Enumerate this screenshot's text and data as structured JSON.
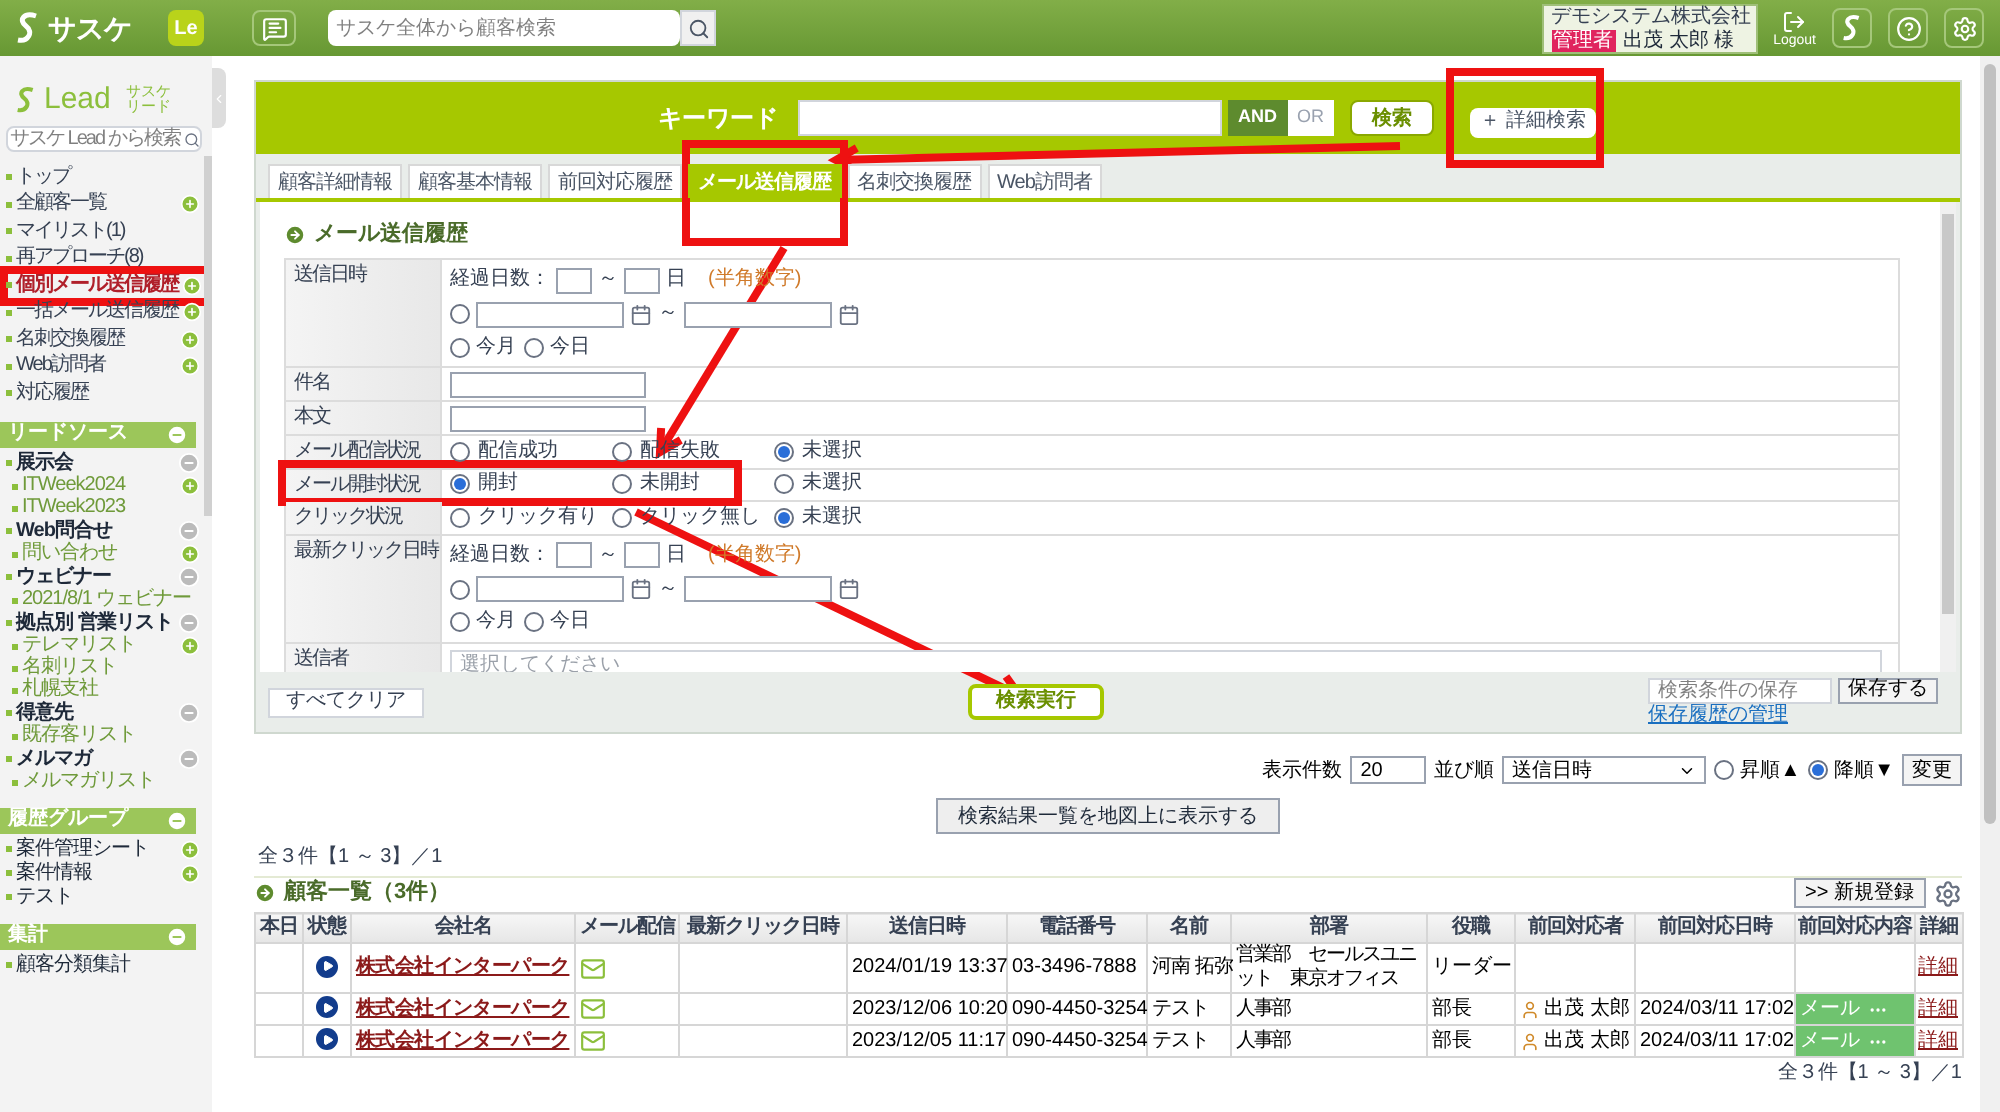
{
  "header": {
    "logo": "サスケ",
    "app_badge": "Le",
    "search_placeholder": "サスケ全体から顧客検索",
    "company": "デモシステム株式会社",
    "role": "管理者",
    "user": "出茂 太郎 様",
    "logout": "Logout"
  },
  "sidebar": {
    "logo": "Lead",
    "logo_sub": "サスケリード",
    "search_placeholder": "サスケ Lead から検索",
    "nav": [
      {
        "label": "トップ",
        "add": false,
        "selected": false
      },
      {
        "label": "全顧客一覧",
        "add": true,
        "selected": false
      },
      {
        "label": "マイリスト(1)",
        "add": false,
        "selected": false
      },
      {
        "label": "再アプローチ(8)",
        "add": false,
        "selected": false
      },
      {
        "label": "個別メール送信履歴",
        "add": true,
        "selected": true
      },
      {
        "label": "一括メール送信履歴",
        "add": true,
        "selected": false
      },
      {
        "label": "名刺交換履歴",
        "add": true,
        "selected": false
      },
      {
        "label": "Web訪問者",
        "add": true,
        "selected": false
      },
      {
        "label": "対応履歴",
        "add": false,
        "selected": false
      }
    ],
    "sections": [
      {
        "title": "リードソース",
        "items": [
          {
            "label": "展示会",
            "add": false,
            "children": [
              {
                "label": "ITWeek2024",
                "add": true
              },
              {
                "label": "ITWeek2023",
                "add": false
              }
            ]
          },
          {
            "label": "Web問合せ",
            "add": false,
            "children": [
              {
                "label": "問い合わせ",
                "add": true
              }
            ]
          },
          {
            "label": "ウェビナー",
            "add": false,
            "children": [
              {
                "label": "2021/8/1 ウェビナー",
                "add": false
              }
            ]
          },
          {
            "label": "拠点別 営業リスト",
            "add": false,
            "children": [
              {
                "label": "テレマリスト",
                "add": true
              },
              {
                "label": "名刺リスト",
                "add": false
              },
              {
                "label": "札幌支社",
                "add": false
              }
            ]
          },
          {
            "label": "得意先",
            "add": false,
            "children": [
              {
                "label": "既存客リスト",
                "add": false
              }
            ]
          },
          {
            "label": "メルマガ",
            "add": false,
            "children": [
              {
                "label": "メルマガリスト",
                "add": false
              }
            ]
          }
        ]
      },
      {
        "title": "履歴グループ",
        "items": [
          {
            "label": "案件管理シート",
            "add": true
          },
          {
            "label": "案件情報",
            "add": true
          },
          {
            "label": "テスト",
            "add": false
          }
        ]
      },
      {
        "title": "集計",
        "items": [
          {
            "label": "顧客分類集計",
            "add": false
          }
        ]
      }
    ]
  },
  "search": {
    "keyword_label": "キーワード",
    "logic": [
      {
        "label": "AND",
        "selected": true
      },
      {
        "label": "OR",
        "selected": false
      }
    ],
    "search_button": "検索",
    "advanced_button": "＋ 詳細検索",
    "tabs": [
      {
        "label": "顧客詳細情報",
        "selected": false
      },
      {
        "label": "顧客基本情報",
        "selected": false
      },
      {
        "label": "前回対応履歴",
        "selected": false
      },
      {
        "label": "メール送信履歴",
        "selected": true
      },
      {
        "label": "名刺交換履歴",
        "selected": false
      },
      {
        "label": "Web訪問者",
        "selected": false
      }
    ],
    "heading": "メール送信履歴",
    "rows": [
      {
        "kind": "date",
        "label": "送信日時",
        "days_label": "経過日数：",
        "tilde": "～",
        "day_unit": "日",
        "hint": "(半角数字)",
        "range_tilde": "～",
        "range_selected": false,
        "options": [
          {
            "label": "今月",
            "selected": false
          },
          {
            "label": "今日",
            "selected": false
          }
        ]
      },
      {
        "kind": "text",
        "label": "件名"
      },
      {
        "kind": "text",
        "label": "本文"
      },
      {
        "kind": "radio",
        "label": "メール配信状況",
        "options": [
          {
            "label": "配信成功",
            "selected": false
          },
          {
            "label": "配信失敗",
            "selected": false
          },
          {
            "label": "未選択",
            "selected": true
          }
        ]
      },
      {
        "kind": "radio",
        "label": "メール開封状況",
        "options": [
          {
            "label": "開封",
            "selected": true
          },
          {
            "label": "未開封",
            "selected": false
          },
          {
            "label": "未選択",
            "selected": false
          }
        ]
      },
      {
        "kind": "radio",
        "label": "クリック状況",
        "options": [
          {
            "label": "クリック有り",
            "selected": false
          },
          {
            "label": "クリック無し",
            "selected": false
          },
          {
            "label": "未選択",
            "selected": true
          }
        ]
      },
      {
        "kind": "date",
        "label": "最新クリック日時",
        "days_label": "経過日数：",
        "tilde": "～",
        "day_unit": "日",
        "hint": "(半角数字)",
        "range_tilde": "～",
        "range_selected": false,
        "options": [
          {
            "label": "今月",
            "selected": false
          },
          {
            "label": "今日",
            "selected": false
          }
        ]
      },
      {
        "kind": "select",
        "label": "送信者",
        "placeholder": "選択してください"
      }
    ],
    "clear_button": "すべてクリア",
    "run_button": "検索実行",
    "save_placeholder": "検索条件の保存",
    "save_button": "保存する",
    "history_link": "保存履歴の管理"
  },
  "list_controls": {
    "count_label": "表示件数",
    "count": "20",
    "sort_label": "並び順",
    "sort": "送信日時",
    "orders": [
      {
        "label": "昇順▲",
        "selected": false
      },
      {
        "label": "降順▼",
        "selected": true
      }
    ],
    "apply_button": "変更",
    "map_button": "検索結果一覧を地図上に表示する"
  },
  "results": {
    "pager": "全３件【1 ～ 3】／1",
    "heading": "顧客一覧（3件）",
    "new_button": ">> 新規登録",
    "columns": [
      "本日",
      "状態",
      "会社名",
      "メール配信",
      "最新クリック日時",
      "送信日時",
      "電話番号",
      "名前",
      "部署",
      "役職",
      "前回対応者",
      "前回対応日時",
      "前回対応内容",
      "詳細"
    ],
    "rows": [
      {
        "company": "株式会社インターパーク",
        "sent": "2024/01/19 13:37",
        "phone": "03-3496-7888",
        "name": "河南 拓弥",
        "dept": "営業部　セールスユニット　東京オフィス",
        "title": "リーダー",
        "last_person": "",
        "last_date": "",
        "last_content": "",
        "detail": "詳細"
      },
      {
        "company": "株式会社インターパーク",
        "sent": "2023/12/06 10:20",
        "phone": "090-4450-3254",
        "name": "テスト",
        "dept": "人事部",
        "title": "部長",
        "last_person": "出茂 太郎",
        "last_date": "2024/03/11 17:02",
        "last_content": "メール",
        "detail": "詳細"
      },
      {
        "company": "株式会社インターパーク",
        "sent": "2023/12/05 11:17",
        "phone": "090-4450-3254",
        "name": "テスト",
        "dept": "人事部",
        "title": "部長",
        "last_person": "出茂 太郎",
        "last_date": "2024/03/11 17:02",
        "last_content": "メール",
        "detail": "詳細"
      }
    ],
    "bottom_pager": "全３件【1 ～ 3】／1"
  }
}
